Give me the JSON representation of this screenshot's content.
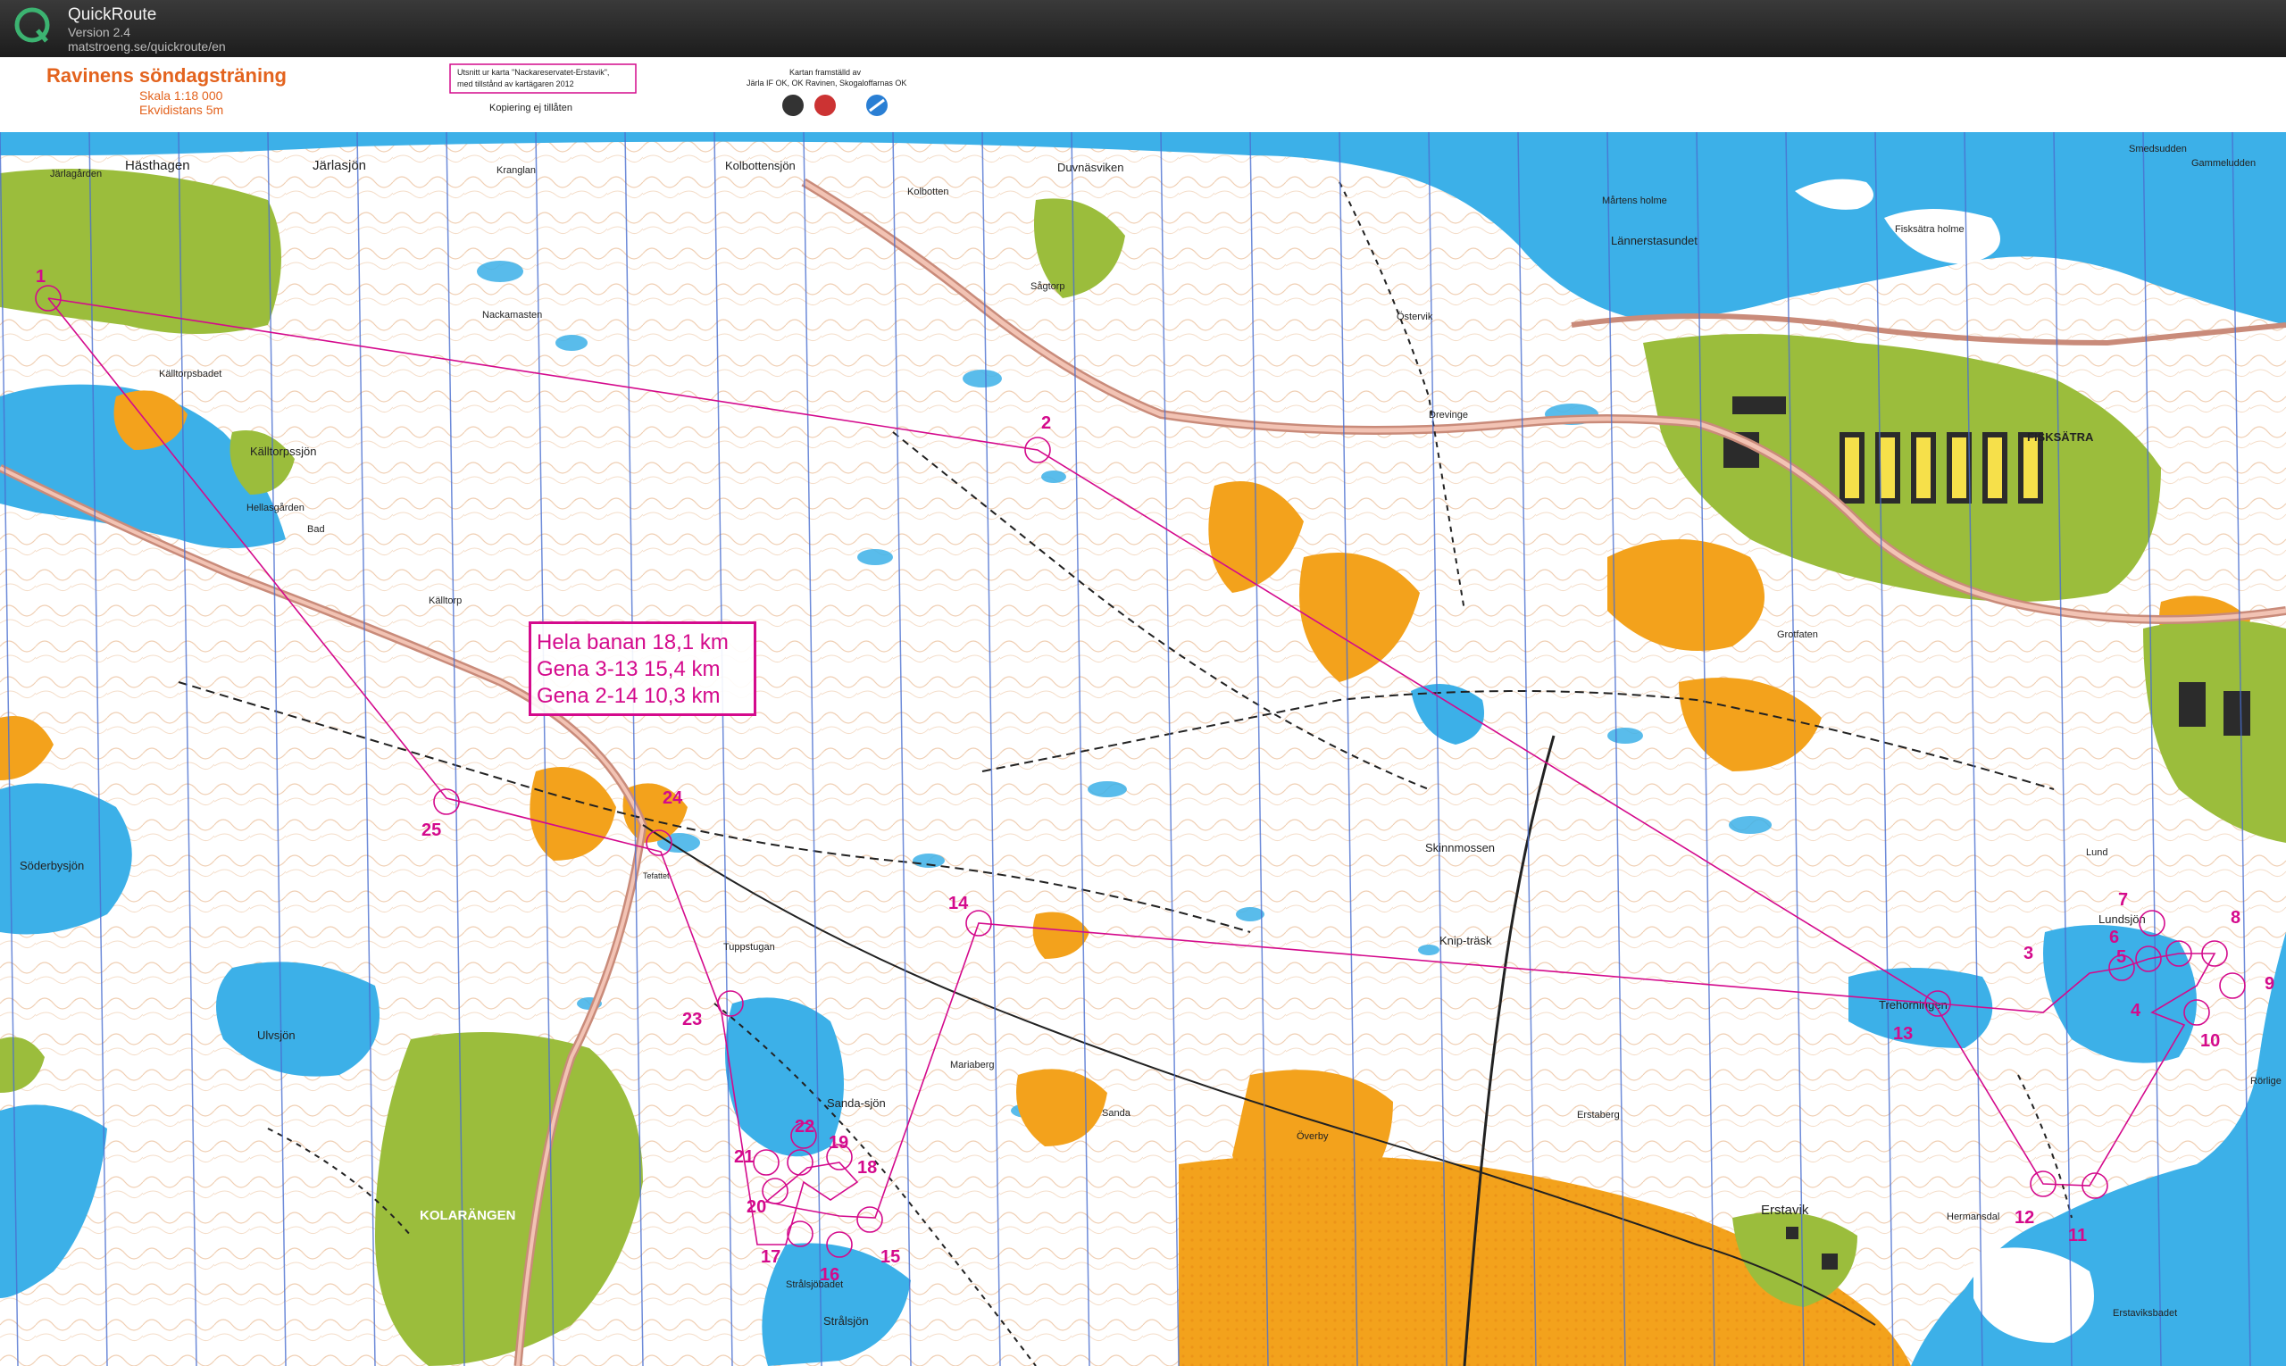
{
  "app": {
    "name": "QuickRoute",
    "version": "Version 2.4",
    "url": "matstroeng.se/quickroute/en"
  },
  "map": {
    "title": "Ravinens söndagsträning",
    "scale": "Skala 1:18 000",
    "contour": "Ekvidistans 5m",
    "notice_lines": [
      "Utsnitt ur karta \"Nackareservatet-Erstavik\",",
      "med tillstånd av kartägaren 2012"
    ],
    "copy_notice": "Kopiering ej tillåten",
    "credit_lines": [
      "Kartan framställd av",
      "Järla IF OK, OK Ravinen, Skogaloffarnas OK"
    ],
    "course_info": [
      "Hela banan 18,1 km",
      "Gena 3-13 15,4 km",
      "Gena 2-14 10,3 km"
    ],
    "colors": {
      "water": "#3cb0e8",
      "open_land": "#f3a21c",
      "forest": "#ffffff",
      "green": "#9bbd3c",
      "contour": "#d8843c",
      "course": "#d40a8c",
      "north_lines": "#4a6fd0"
    },
    "place_names": [
      "Hästhagen",
      "Järlasjön",
      "Järlagården",
      "Kranglan",
      "Kolbottensjön",
      "Kolbotten",
      "Duvnäsviken",
      "Smedsudden",
      "Gammeludden",
      "Mårtens holme",
      "Lännerstasundet",
      "Fisksätra holme",
      "Nackamasten",
      "Källtorpsbadet",
      "Källtorpssjön",
      "Hellasgården",
      "Bad",
      "Källtorp",
      "Sågtorp",
      "Östervik",
      "Drevinge",
      "FISKSÄTRA",
      "Grotfaten",
      "Söderbysjön",
      "Tefattet",
      "Tuppstugan",
      "Ulvsjön",
      "Sanda-sjön",
      "Mariaberg",
      "Sanda",
      "Överby",
      "Erstaberg",
      "Skinnmossen",
      "Knip-träsk",
      "Trehörningen",
      "Lundsjön",
      "Lund",
      "Rörlige",
      "Hermansdal",
      "Erstavik",
      "Erstaviksbadet",
      "KOLARÄNGEN",
      "Strålsjön",
      "Strålsjöbadet"
    ],
    "controls": [
      {
        "label": "1"
      },
      {
        "label": "2"
      },
      {
        "label": "3"
      },
      {
        "label": "4"
      },
      {
        "label": "5"
      },
      {
        "label": "6"
      },
      {
        "label": "7"
      },
      {
        "label": "8"
      },
      {
        "label": "9"
      },
      {
        "label": "10"
      },
      {
        "label": "11"
      },
      {
        "label": "12"
      },
      {
        "label": "13"
      },
      {
        "label": "14"
      },
      {
        "label": "15"
      },
      {
        "label": "16"
      },
      {
        "label": "17"
      },
      {
        "label": "18"
      },
      {
        "label": "19"
      },
      {
        "label": "20"
      },
      {
        "label": "21"
      },
      {
        "label": "22"
      },
      {
        "label": "23"
      },
      {
        "label": "24"
      },
      {
        "label": "25"
      }
    ]
  }
}
